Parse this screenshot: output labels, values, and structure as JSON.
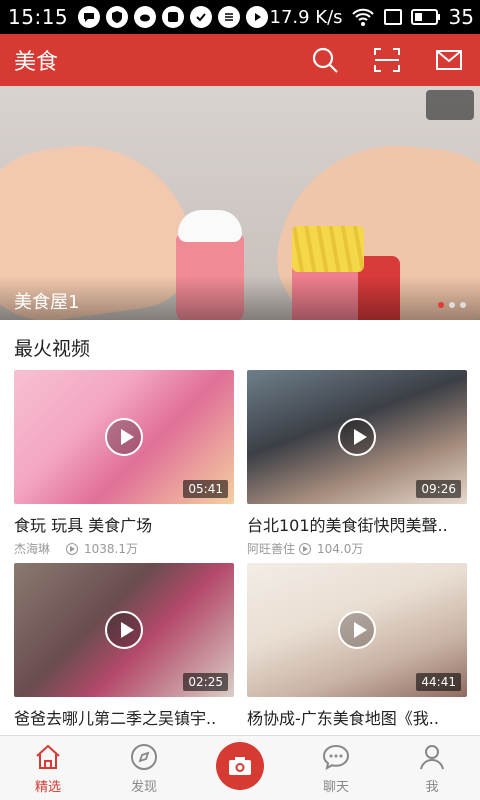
{
  "status_bar": {
    "time": "15:15",
    "speed": "17.9 K/s",
    "battery": "35"
  },
  "app_bar": {
    "title": "美食"
  },
  "banner": {
    "caption": "美食屋1",
    "dots": 3,
    "active_dot": 0
  },
  "section": {
    "title": "最火视频"
  },
  "videos": [
    {
      "title": "食玩 玩具 美食广场",
      "author": "杰海琳",
      "plays": "1038.1万",
      "duration": "05:41"
    },
    {
      "title": "台北101的美食街快閃美聲..",
      "author": "阿旺善住",
      "plays": "104.0万",
      "duration": "09:26"
    },
    {
      "title": "爸爸去哪儿第二季之吴镇宇..",
      "author": "",
      "plays": "",
      "duration": "02:25"
    },
    {
      "title": "杨协成-广东美食地图《我..",
      "author": "",
      "plays": "",
      "duration": "44:41"
    }
  ],
  "bottom_nav": {
    "items": [
      {
        "label": "精选",
        "icon": "home-icon"
      },
      {
        "label": "发现",
        "icon": "compass-icon"
      },
      {
        "label": "",
        "icon": "camera-icon"
      },
      {
        "label": "聊天",
        "icon": "chat-icon"
      },
      {
        "label": "我",
        "icon": "person-icon"
      }
    ]
  },
  "colors": {
    "accent": "#d63a32",
    "status_bar_bg": "#000000",
    "text_primary": "#222222",
    "text_secondary": "#999999"
  }
}
